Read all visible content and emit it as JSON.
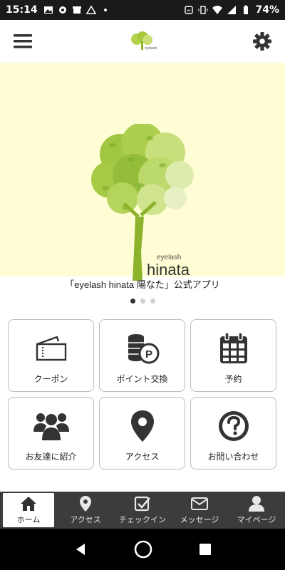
{
  "status_bar": {
    "time": "15:14",
    "battery": "74%"
  },
  "app_bar": {
    "menu_icon": "hamburger-menu-icon",
    "logo_text": "eyelash",
    "settings_icon": "gear-icon"
  },
  "hero": {
    "logo_small": "eyelash",
    "logo_big": "hinata",
    "caption": "「eyelash hinata 陽なた」公式アプリ",
    "slides_total": 3,
    "active_slide": 1
  },
  "menu_tiles": [
    {
      "label": "クーポン",
      "icon": "ticket-icon"
    },
    {
      "label": "ポイント交換",
      "icon": "coins-icon"
    },
    {
      "label": "予約",
      "icon": "calendar-icon"
    },
    {
      "label": "お友達に紹介",
      "icon": "users-icon"
    },
    {
      "label": "アクセス",
      "icon": "map-pin-icon"
    },
    {
      "label": "お問い合わせ",
      "icon": "question-circle-icon"
    }
  ],
  "bottom_nav": [
    {
      "label": "ホーム",
      "icon": "home-icon",
      "active": true
    },
    {
      "label": "アクセス",
      "icon": "map-pin-icon",
      "active": false
    },
    {
      "label": "チェックイン",
      "icon": "checkbox-icon",
      "active": false
    },
    {
      "label": "メッセージ",
      "icon": "envelope-icon",
      "active": false
    },
    {
      "label": "マイページ",
      "icon": "person-icon",
      "active": false
    }
  ],
  "colors": {
    "hero_bg": "#fffdd3",
    "bottom_nav_bg": "#3c3c3c",
    "leaf_green": "#9bc43b",
    "trunk_green": "#8db32d"
  }
}
